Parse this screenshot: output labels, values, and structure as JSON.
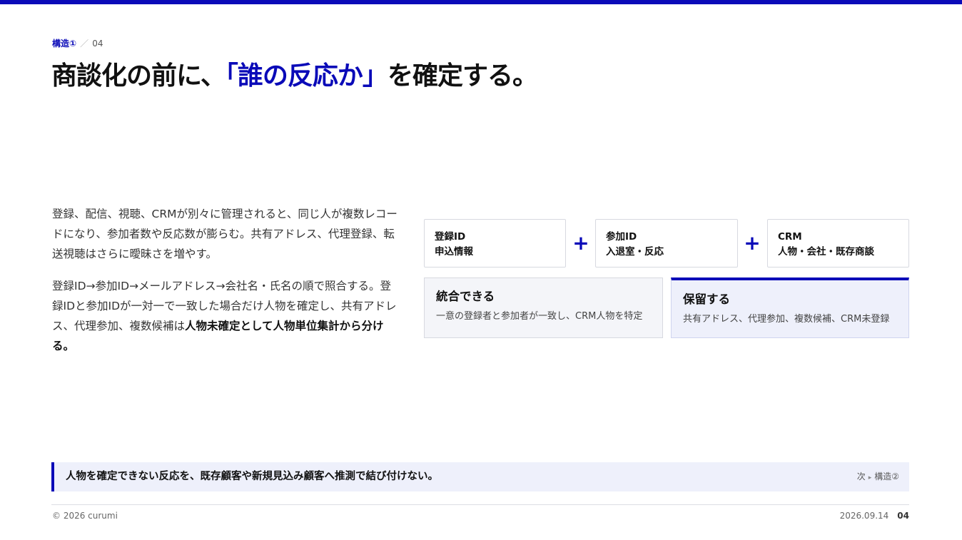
{
  "header": {
    "section": "構造①",
    "separator": "／",
    "page_number": "04",
    "title_before": "商談化の前に、",
    "title_accent": "「誰の反応か」",
    "title_after": "を確定する。"
  },
  "body": {
    "paragraph1": "登録、配信、視聴、CRMが別々に管理されると、同じ人が複数レコードになり、参加者数や反応数が膨らむ。共有アドレス、代理登録、転送視聴はさらに曖昧さを増やす。",
    "paragraph2_plain": "登録ID→参加ID→メールアドレス→会社名・氏名の順で照合する。登録IDと参加IDが一対一で一致した場合だけ人物を確定し、共有アドレス、代理参加、複数候補は",
    "paragraph2_bold": "人物未確定として人物単位集計から分ける。"
  },
  "diagram": {
    "sources": [
      {
        "label": "登録ID",
        "detail": "申込情報"
      },
      {
        "label": "参加ID",
        "detail": "入退室・反応"
      },
      {
        "label": "CRM",
        "detail": "人物・会社・既存商談"
      }
    ],
    "plus": "+",
    "results": [
      {
        "title": "統合できる",
        "desc": "一意の登録者と参加者が一致し、CRM人物を特定"
      },
      {
        "title": "保留する",
        "desc": "共有アドレス、代理参加、複数候補、CRM未登録"
      }
    ]
  },
  "banner": {
    "message": "人物を確定できない反応を、既存顧客や新規見込み顧客へ推測で結び付けない。",
    "next_label": "次",
    "next_arrow": "▸",
    "next_target": "構造②"
  },
  "footer": {
    "copyright": "© 2026 curumi",
    "date": "2026.09.14",
    "page": "04"
  },
  "colors": {
    "accent": "#0a0ab8",
    "panel": "#eef0fb"
  }
}
